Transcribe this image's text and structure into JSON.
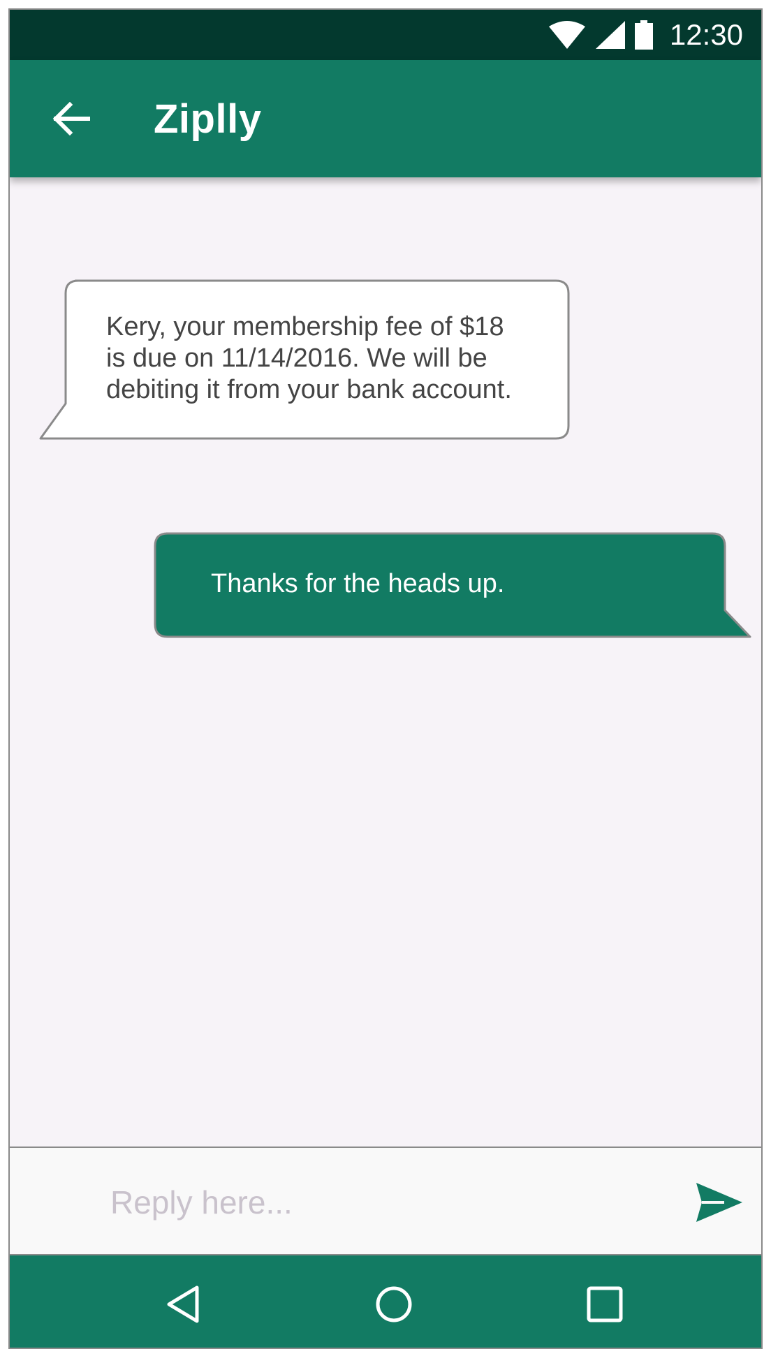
{
  "status_bar": {
    "time": "12:30",
    "icons": [
      "wifi-icon",
      "signal-icon",
      "battery-icon"
    ]
  },
  "app_bar": {
    "back_icon": "arrow-left-icon",
    "title": "Ziplly"
  },
  "messages": [
    {
      "direction": "incoming",
      "text": "Kery, your membership fee of $18\nis due on 11/14/2016. We will be\ndebiting it from your bank account."
    },
    {
      "direction": "outgoing",
      "text": "Thanks for the heads up."
    }
  ],
  "reply": {
    "placeholder": "Reply here...",
    "value": "",
    "send_icon": "send-icon"
  },
  "nav_bar": {
    "icons": [
      "back-triangle-icon",
      "home-circle-icon",
      "recents-square-icon"
    ]
  },
  "colors": {
    "status_bar": "#03392e",
    "primary": "#127b63",
    "chat_background": "#f7f3f8",
    "incoming_bubble": "#ffffff",
    "outgoing_bubble": "#127b63",
    "bubble_border": "#8a8a8a"
  }
}
